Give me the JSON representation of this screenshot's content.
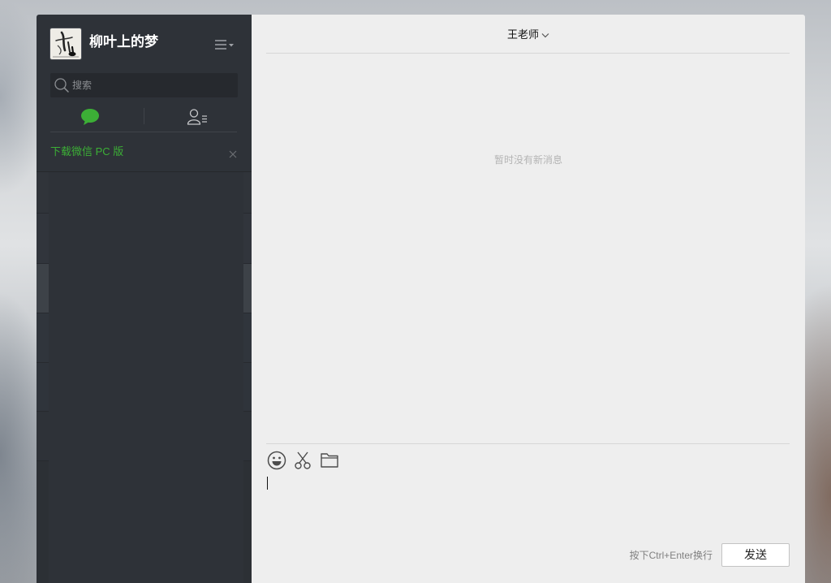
{
  "user": {
    "name": "柳叶上的梦",
    "avatar_icon": "avatar-image"
  },
  "sidebar": {
    "menu_icon": "menu-icon",
    "search": {
      "placeholder": "搜索",
      "icon": "search-icon"
    },
    "tabs": [
      {
        "icon": "chat-bubble-icon",
        "active": true
      },
      {
        "icon": "contacts-icon",
        "active": false
      }
    ],
    "banner": {
      "text": "下载微信 PC 版",
      "close_icon": "close-icon"
    }
  },
  "chat": {
    "title": "王老师",
    "title_icon": "chevron-down-icon",
    "empty_text": "暂时没有新消息"
  },
  "editor": {
    "toolbar": [
      {
        "icon": "emoji-icon"
      },
      {
        "icon": "scissors-icon"
      },
      {
        "icon": "folder-icon"
      }
    ],
    "hint": "按下Ctrl+Enter换行",
    "send_label": "发送"
  },
  "colors": {
    "accent": "#3caf36",
    "sidebar_bg": "#2e3238",
    "main_bg": "#eeeeee"
  }
}
